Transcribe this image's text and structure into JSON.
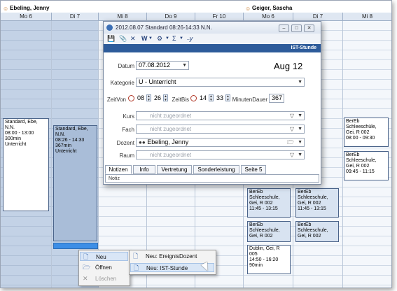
{
  "persons": [
    {
      "name": "Ebeling, Jenny"
    },
    {
      "name": "Geiger, Sascha"
    }
  ],
  "days": [
    "Mo 6",
    "Di 7",
    "Mi 8",
    "Do 9",
    "Fr 10",
    "Mo 6",
    "Di 7",
    "Mi 8"
  ],
  "appointments": {
    "a1": [
      "Standard, Ebe,",
      "N.N.",
      "08:00 - 13:00",
      "300min",
      "Unterricht"
    ],
    "a2": [
      "Standard, Ebe,",
      "N.N.",
      "08:26 - 14:33",
      "367min",
      "Unterricht"
    ],
    "a3": [
      "BerEb",
      "Schleeschüle,",
      "Gei, R 002",
      "08:00 - 09:30"
    ],
    "a4": [
      "BerEb",
      "Schleeschule,",
      "Gei, R 002",
      "09:45 - 11:15"
    ],
    "a5": [
      "BerEb",
      "Schleeschule,",
      "Gei, R 002",
      "11:45 - 13:15"
    ],
    "a6": [
      "BerEb",
      "Schleeschule,",
      "Gei, R 002",
      "11:45 - 13:15"
    ],
    "a7": [
      "BerEb",
      "Schleeschule,",
      "Gei, R 002"
    ],
    "a8": [
      "BerEb",
      "Schleeschule,",
      "Gei, R 002"
    ],
    "a9": [
      "Dublin, Gei, R",
      "005",
      "14:50 - 16:20",
      "90min"
    ]
  },
  "dialog": {
    "title": "2012.08.07 Standard 08:26-14:33 N.N.",
    "band": "IST-Stunde",
    "datum_label": "Datum",
    "datum_value": "07.08.2012",
    "date_display": "Aug 12",
    "kategorie_label": "Kategorie",
    "kategorie_value": "U - Unterricht",
    "zeitvon_label": "ZeitVon",
    "zeitvon_h": "08",
    "zeitvon_m": "26",
    "zeitbis_label": "ZeitBis",
    "zeitbis_h": "14",
    "zeitbis_m": "33",
    "minuten_label": "MinutenDauer",
    "minuten_value": "367",
    "kurs_label": "Kurs",
    "fach_label": "Fach",
    "dozent_label": "Dozent",
    "raum_label": "Raum",
    "placeholder": "nicht zugeordnet",
    "dozent_value": "Ebeling, Jenny",
    "tabs": [
      "Notizen",
      "Info",
      "Vertretung",
      "Sonderleistung",
      "Seite 5"
    ],
    "notiz": "Notiz"
  },
  "menu": {
    "items": [
      "Neu",
      "Öffnen",
      "Löschen"
    ],
    "sub": [
      "Neu: EreignisDozent",
      "Neu: IST-Stunde"
    ]
  },
  "colors": {
    "band": "#2d5b9a",
    "appointment_border": "#4b648a",
    "selection": "#3d8ee6"
  }
}
